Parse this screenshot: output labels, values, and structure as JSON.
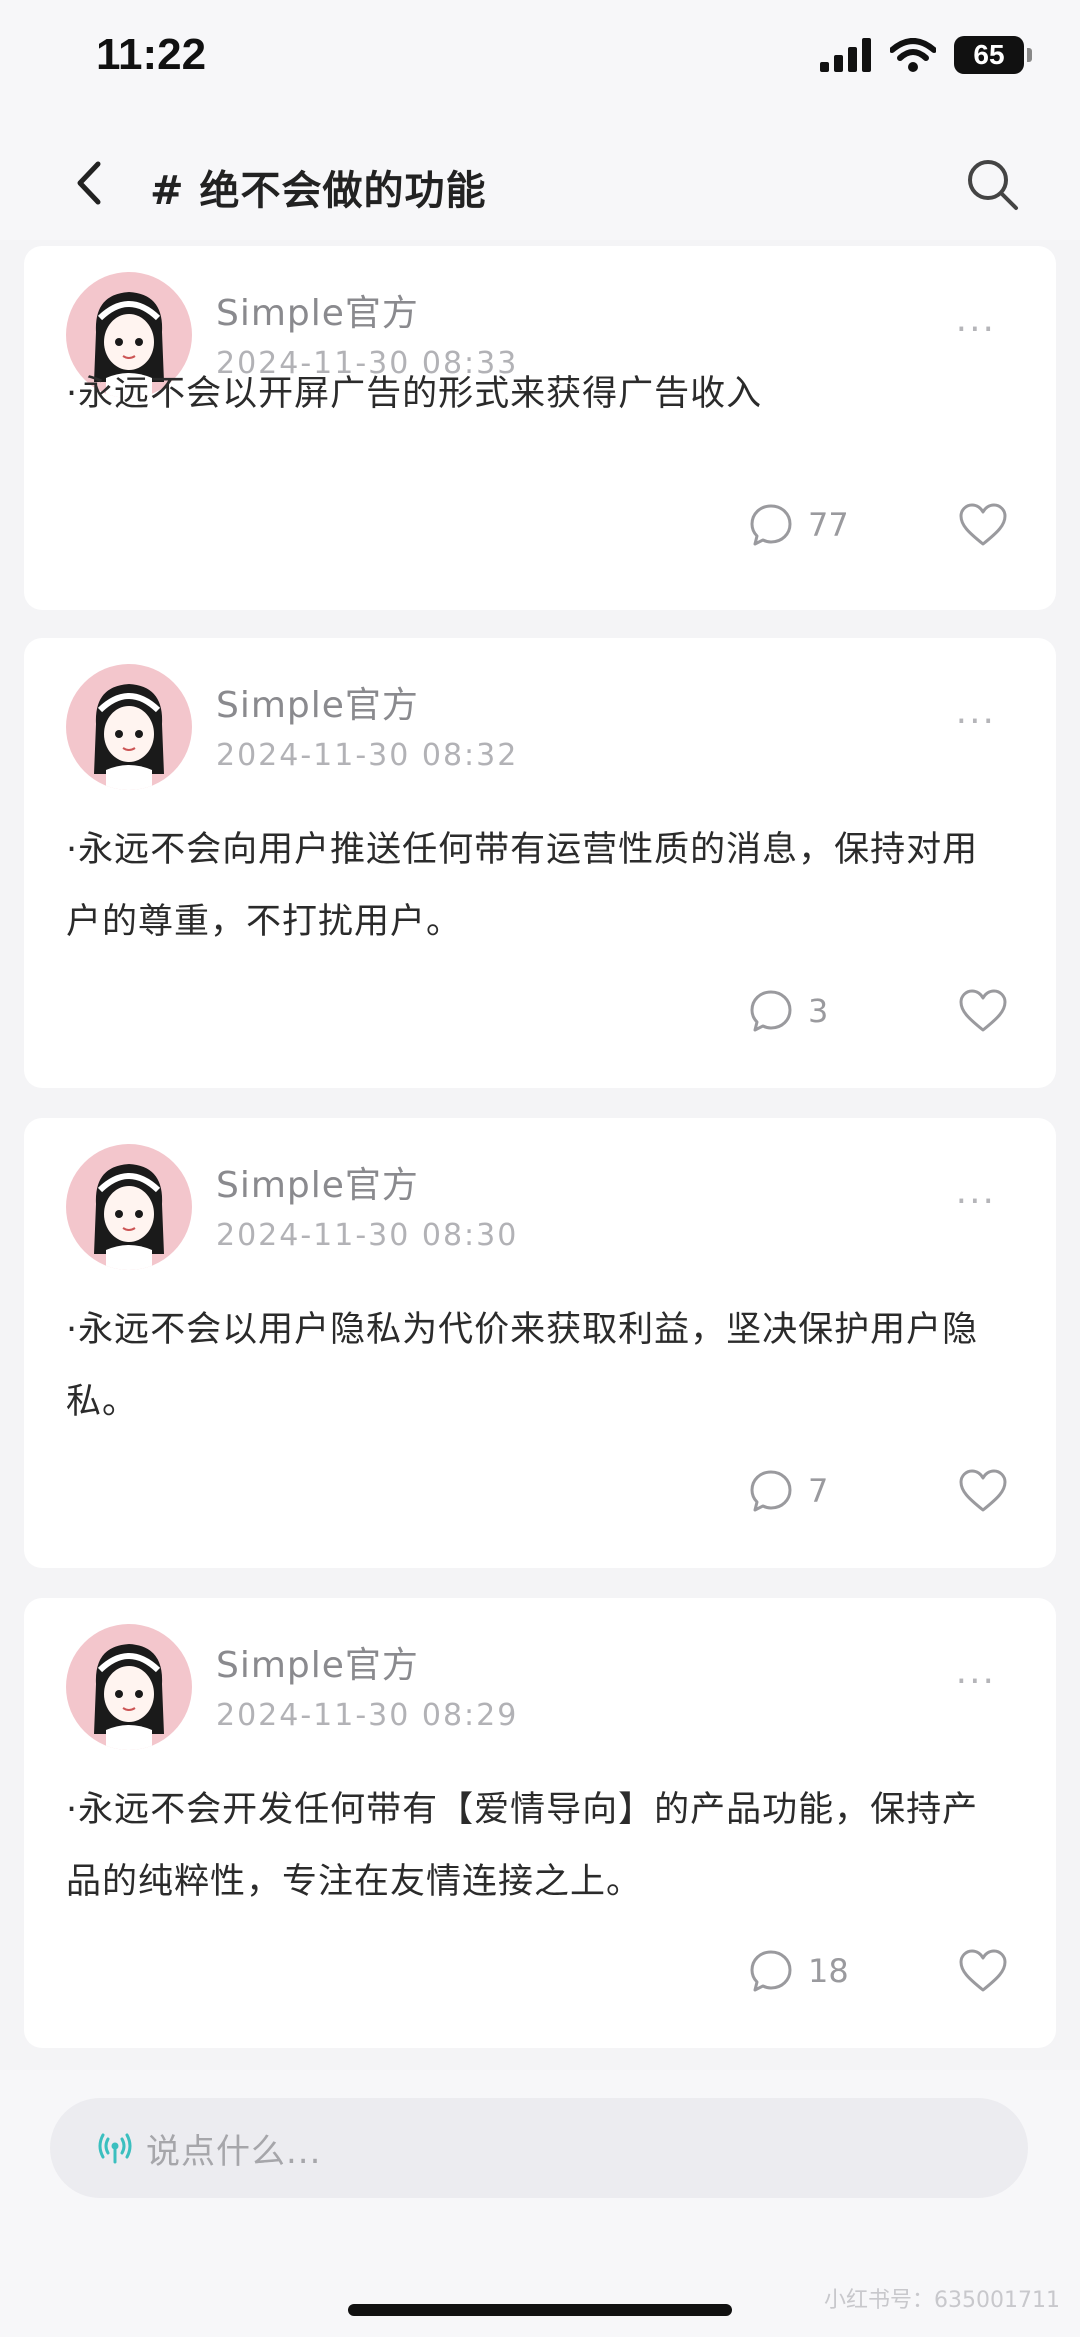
{
  "status_bar": {
    "time": "11:22",
    "battery": "65"
  },
  "nav": {
    "title": "# 绝不会做的功能"
  },
  "posts": [
    {
      "author": "Simple官方",
      "time": "2024-11-30 08:33",
      "text": "·永远不会以开屏广告的形式来获得广告收入",
      "comments": "77"
    },
    {
      "author": "Simple官方",
      "time": "2024-11-30 08:32",
      "text": "·永远不会向用户推送任何带有运营性质的消息，保持对用户的尊重，不打扰用户。",
      "comments": "3"
    },
    {
      "author": "Simple官方",
      "time": "2024-11-30 08:30",
      "text": "·永远不会以用户隐私为代价来获取利益，坚决保护用户隐私。",
      "comments": "7"
    },
    {
      "author": "Simple官方",
      "time": "2024-11-30 08:29",
      "text": "·永远不会开发任何带有【爱情导向】的产品功能，保持产品的纯粹性，专注在友情连接之上。",
      "comments": "18"
    }
  ],
  "input": {
    "placeholder": "说点什么..."
  },
  "watermark": "小红书号：635001711",
  "colors": {
    "accent": "#3bbfbf",
    "avatar_bg": "#f3c6cc",
    "card_bg": "#ffffff",
    "page_bg": "#f4f4f6"
  }
}
